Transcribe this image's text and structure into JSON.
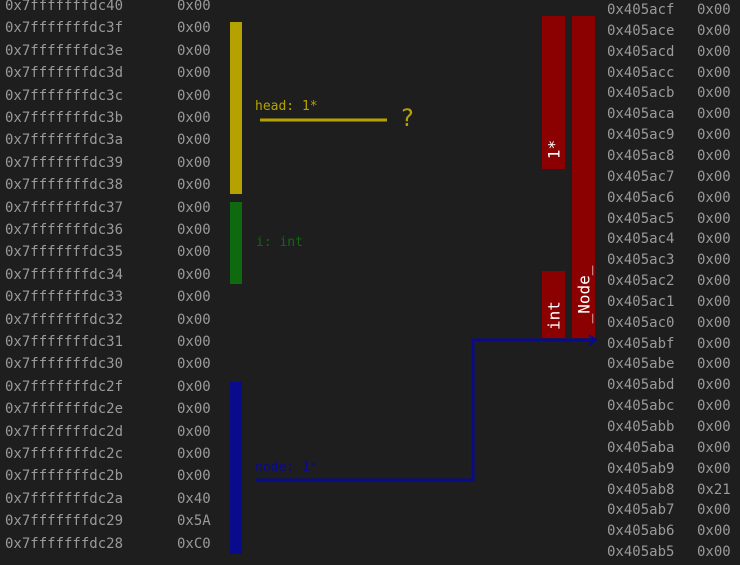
{
  "stack": [
    {
      "addr": "0x7fffffffdc40",
      "val": "0x00"
    },
    {
      "addr": "0x7fffffffdc3f",
      "val": "0x00"
    },
    {
      "addr": "0x7fffffffdc3e",
      "val": "0x00"
    },
    {
      "addr": "0x7fffffffdc3d",
      "val": "0x00"
    },
    {
      "addr": "0x7fffffffdc3c",
      "val": "0x00"
    },
    {
      "addr": "0x7fffffffdc3b",
      "val": "0x00"
    },
    {
      "addr": "0x7fffffffdc3a",
      "val": "0x00"
    },
    {
      "addr": "0x7fffffffdc39",
      "val": "0x00"
    },
    {
      "addr": "0x7fffffffdc38",
      "val": "0x00"
    },
    {
      "addr": "0x7fffffffdc37",
      "val": "0x00"
    },
    {
      "addr": "0x7fffffffdc36",
      "val": "0x00"
    },
    {
      "addr": "0x7fffffffdc35",
      "val": "0x00"
    },
    {
      "addr": "0x7fffffffdc34",
      "val": "0x00"
    },
    {
      "addr": "0x7fffffffdc33",
      "val": "0x00"
    },
    {
      "addr": "0x7fffffffdc32",
      "val": "0x00"
    },
    {
      "addr": "0x7fffffffdc31",
      "val": "0x00"
    },
    {
      "addr": "0x7fffffffdc30",
      "val": "0x00"
    },
    {
      "addr": "0x7fffffffdc2f",
      "val": "0x00"
    },
    {
      "addr": "0x7fffffffdc2e",
      "val": "0x00"
    },
    {
      "addr": "0x7fffffffdc2d",
      "val": "0x00"
    },
    {
      "addr": "0x7fffffffdc2c",
      "val": "0x00"
    },
    {
      "addr": "0x7fffffffdc2b",
      "val": "0x00"
    },
    {
      "addr": "0x7fffffffdc2a",
      "val": "0x40"
    },
    {
      "addr": "0x7fffffffdc29",
      "val": "0x5A"
    },
    {
      "addr": "0x7fffffffdc28",
      "val": "0xC0"
    }
  ],
  "heap": [
    {
      "addr": "0x405acf",
      "val": "0x00"
    },
    {
      "addr": "0x405ace",
      "val": "0x00"
    },
    {
      "addr": "0x405acd",
      "val": "0x00"
    },
    {
      "addr": "0x405acc",
      "val": "0x00"
    },
    {
      "addr": "0x405acb",
      "val": "0x00"
    },
    {
      "addr": "0x405aca",
      "val": "0x00"
    },
    {
      "addr": "0x405ac9",
      "val": "0x00"
    },
    {
      "addr": "0x405ac8",
      "val": "0x00"
    },
    {
      "addr": "0x405ac7",
      "val": "0x00"
    },
    {
      "addr": "0x405ac6",
      "val": "0x00"
    },
    {
      "addr": "0x405ac5",
      "val": "0x00"
    },
    {
      "addr": "0x405ac4",
      "val": "0x00"
    },
    {
      "addr": "0x405ac3",
      "val": "0x00"
    },
    {
      "addr": "0x405ac2",
      "val": "0x00"
    },
    {
      "addr": "0x405ac1",
      "val": "0x00"
    },
    {
      "addr": "0x405ac0",
      "val": "0x00"
    },
    {
      "addr": "0x405abf",
      "val": "0x00"
    },
    {
      "addr": "0x405abe",
      "val": "0x00"
    },
    {
      "addr": "0x405abd",
      "val": "0x00"
    },
    {
      "addr": "0x405abc",
      "val": "0x00"
    },
    {
      "addr": "0x405abb",
      "val": "0x00"
    },
    {
      "addr": "0x405aba",
      "val": "0x00"
    },
    {
      "addr": "0x405ab9",
      "val": "0x00"
    },
    {
      "addr": "0x405ab8",
      "val": "0x21 !"
    },
    {
      "addr": "0x405ab7",
      "val": "0x00"
    },
    {
      "addr": "0x405ab6",
      "val": "0x00"
    },
    {
      "addr": "0x405ab5",
      "val": "0x00"
    }
  ],
  "annotations": {
    "head": "head: 1*",
    "head_unknown": "?",
    "i": "i: int",
    "node": "node: 1*",
    "heap_ptr": "1*",
    "heap_int": "int",
    "heap_struct": "_Node_"
  },
  "colors": {
    "background": "#1e1e1e",
    "text": "#9a9a9a",
    "head": "#b5a200",
    "i": "#0f6a0f",
    "node": "#0a0a8c",
    "heap": "#8b0000"
  }
}
